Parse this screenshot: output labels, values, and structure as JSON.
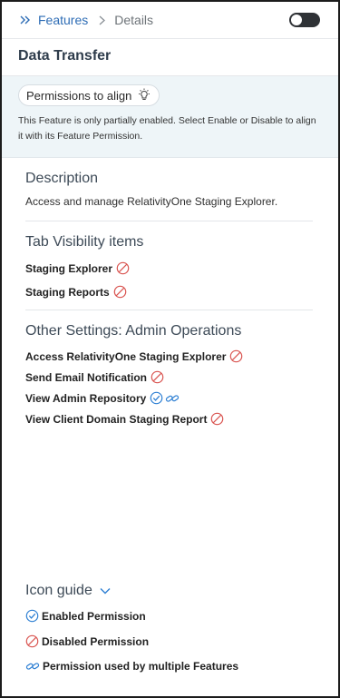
{
  "breadcrumb": {
    "parent": "Features",
    "current": "Details"
  },
  "toggle": {
    "state": "off"
  },
  "title": "Data Transfer",
  "align": {
    "button_label": "Permissions to align",
    "message": "This Feature is only partially enabled. Select Enable or Disable to align it with its Feature Permission."
  },
  "description": {
    "heading": "Description",
    "text": "Access and manage RelativityOne Staging Explorer."
  },
  "tab_visibility": {
    "heading": "Tab Visibility items",
    "items": [
      {
        "label": "Staging Explorer",
        "status": "disabled"
      },
      {
        "label": "Staging Reports",
        "status": "disabled"
      }
    ]
  },
  "other_settings": {
    "heading": "Other Settings: Admin Operations",
    "items": [
      {
        "label": "Access RelativityOne Staging Explorer",
        "status": "disabled"
      },
      {
        "label": "Send Email Notification",
        "status": "disabled"
      },
      {
        "label": "View Admin Repository",
        "status": "enabled",
        "shared": true
      },
      {
        "label": "View Client Domain Staging Report",
        "status": "disabled"
      }
    ]
  },
  "icon_guide": {
    "heading": "Icon guide",
    "entries": [
      {
        "icon": "check-circle-icon",
        "label": "Enabled Permission"
      },
      {
        "icon": "prohibited-icon",
        "label": "Disabled Permission"
      },
      {
        "icon": "link-icon",
        "label": "Permission used by multiple Features"
      }
    ]
  },
  "colors": {
    "accent": "#2d6cb5",
    "disabled": "#d9534f",
    "enabled": "#2d7fd3",
    "panel": "#eef5f8"
  }
}
